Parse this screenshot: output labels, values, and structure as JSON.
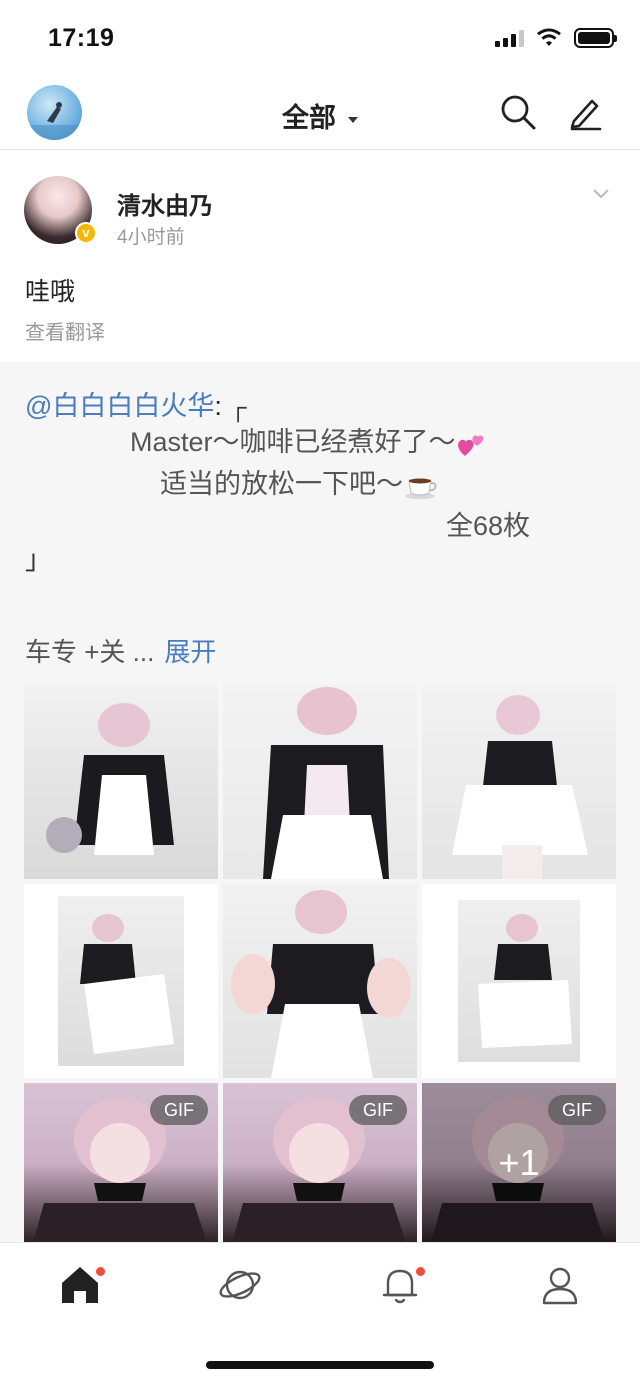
{
  "status_bar": {
    "time": "17:19"
  },
  "nav": {
    "title": "全部",
    "icons": [
      "search-icon",
      "compose-icon"
    ]
  },
  "post": {
    "author": "清水由乃",
    "time": "4小时前",
    "text": "哇哦",
    "translate": "查看翻译"
  },
  "repost": {
    "mention": "@白白白白火华",
    "colon": ":",
    "open_bracket": "┌",
    "line2": "Master～咖啡已经煮好了～",
    "line3": "适当的放松一下吧～",
    "line4": "全68枚",
    "close_bracket": "」",
    "more_text": "车专 +关 ...",
    "expand": "展开"
  },
  "images": [
    {
      "type": "photo"
    },
    {
      "type": "photo"
    },
    {
      "type": "photo"
    },
    {
      "type": "photo"
    },
    {
      "type": "photo"
    },
    {
      "type": "photo"
    },
    {
      "type": "gif",
      "badge": "GIF"
    },
    {
      "type": "gif",
      "badge": "GIF"
    },
    {
      "type": "gif",
      "badge": "GIF",
      "overlay": "+1"
    }
  ],
  "tab_bar": {
    "tabs": [
      "home-icon",
      "discover-icon",
      "notifications-icon",
      "profile-icon"
    ],
    "accent": "#f14b3a"
  },
  "colors": {
    "link": "#4a7cc0",
    "badge": "#f5b800"
  }
}
